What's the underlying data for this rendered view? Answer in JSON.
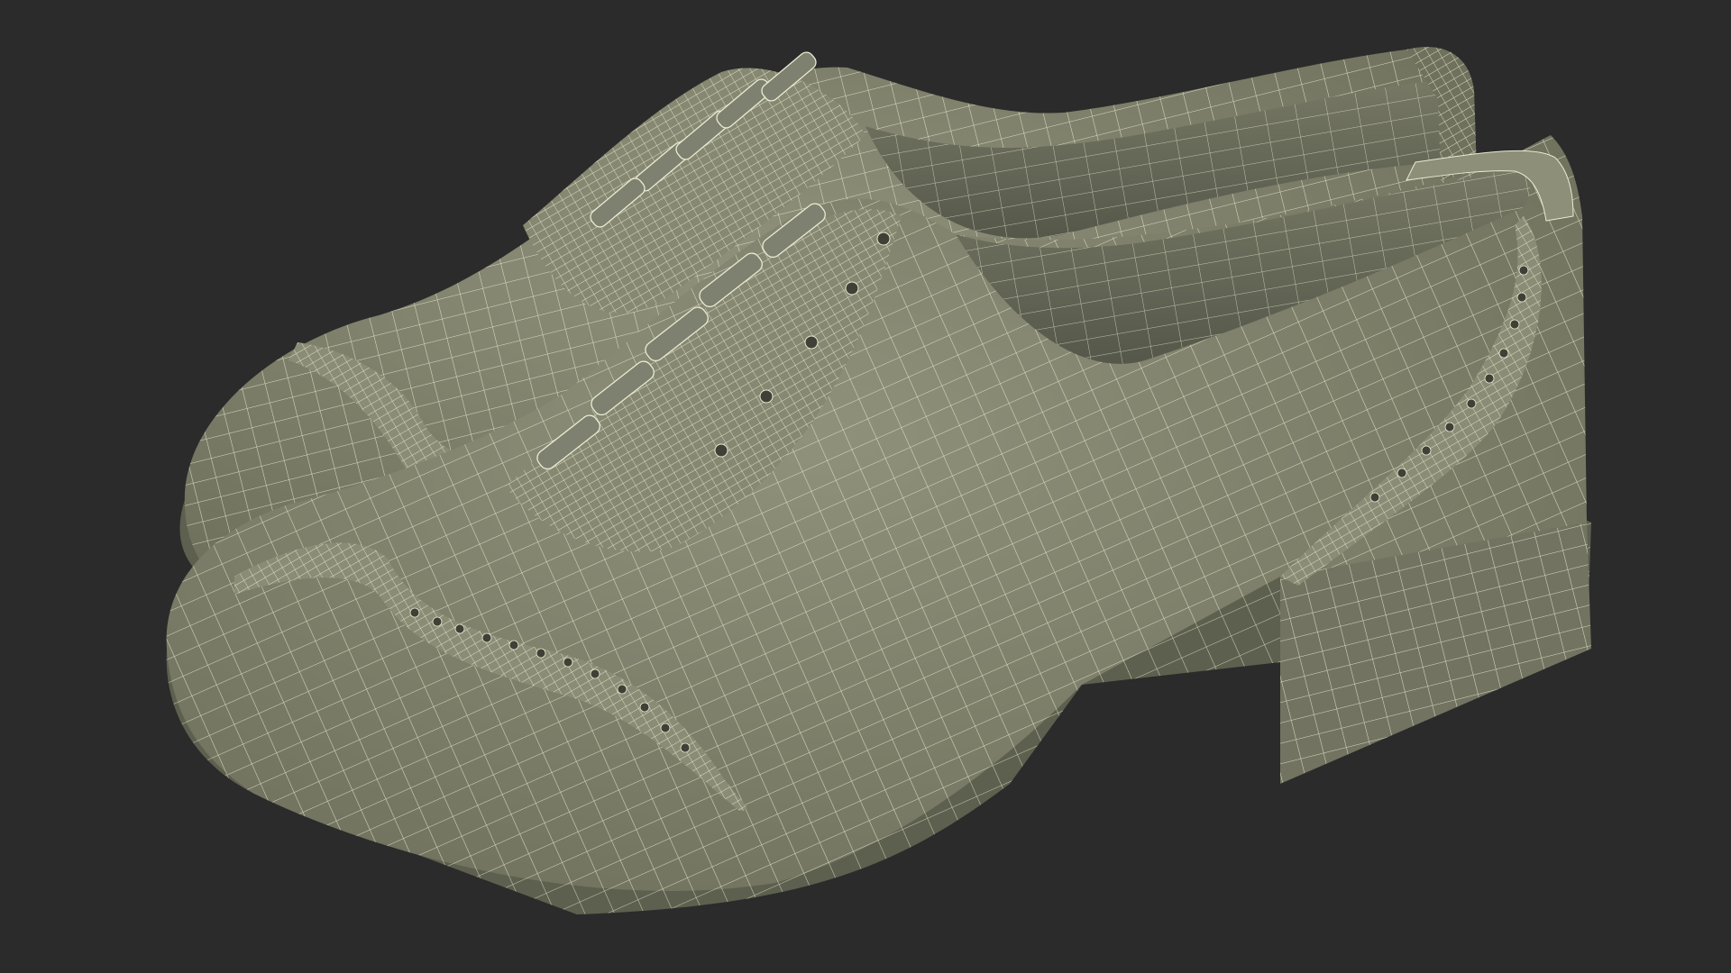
{
  "scene": {
    "subject": "pair-of-wingtip-brogue-shoes",
    "render_mode": "wireframe-over-shaded",
    "colors": {
      "background": "#2b2b2b",
      "surface": "#7d7f6a",
      "surface_dark": "#5e604f",
      "surface_light": "#8f917b",
      "interior": "#696b59",
      "wire": "#e9ecd2",
      "shadow": "#1f1f1f"
    }
  }
}
